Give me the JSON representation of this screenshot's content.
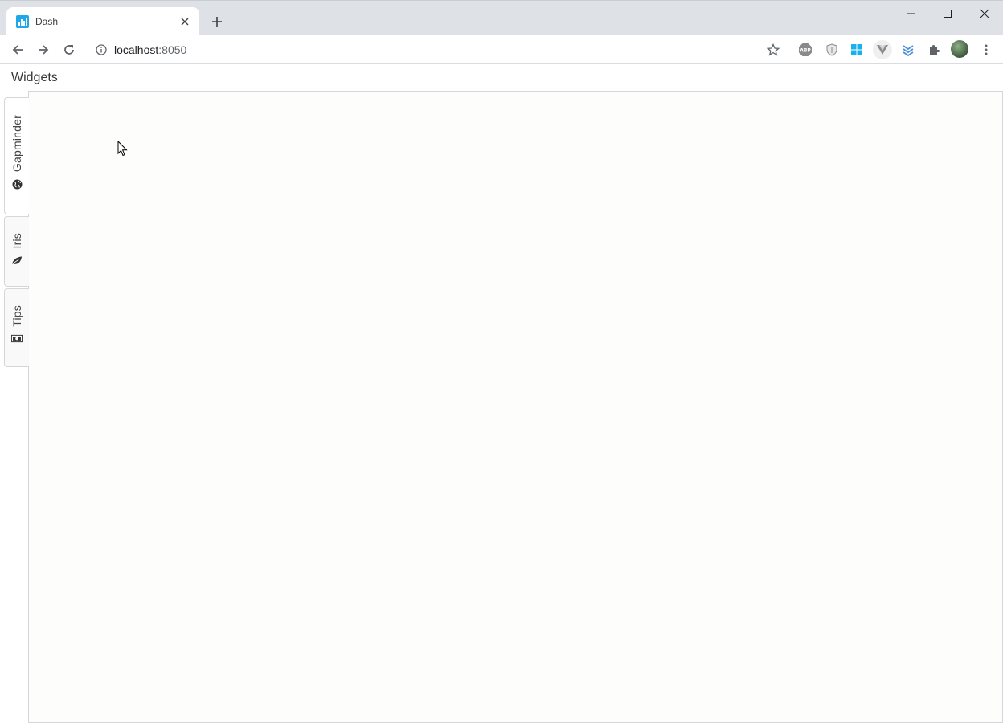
{
  "browser": {
    "tab_title": "Dash",
    "url_host": "localhost",
    "url_port": ":8050"
  },
  "page": {
    "header": "Widgets"
  },
  "tabs": [
    {
      "label": "Gapminder",
      "icon": "globe-icon"
    },
    {
      "label": "Iris",
      "icon": "leaf-icon"
    },
    {
      "label": "Tips",
      "icon": "money-bill-icon"
    }
  ],
  "colors": {
    "favicon": "#1ea8e8",
    "tab_border": "#d6d6d6",
    "panel_bg": "#fdfdfc"
  }
}
